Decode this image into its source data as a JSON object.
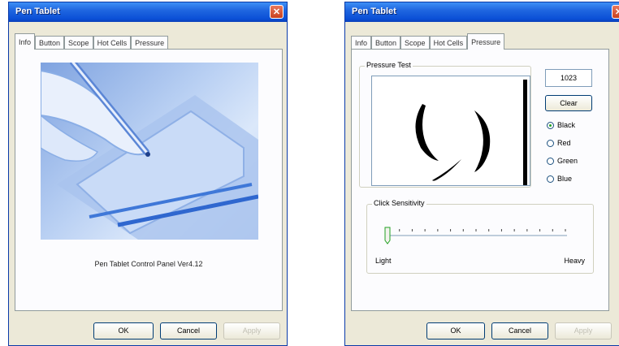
{
  "window_left": {
    "title": "Pen Tablet",
    "tabs": [
      "Info",
      "Button",
      "Scope",
      "Hot Cells",
      "Pressure"
    ],
    "active_tab": "Info",
    "caption": "Pen Tablet Control Panel Ver4.12",
    "buttons": {
      "ok": "OK",
      "cancel": "Cancel",
      "apply": "Apply"
    }
  },
  "window_right": {
    "title": "Pen Tablet",
    "tabs": [
      "Info",
      "Button",
      "Scope",
      "Hot Cells",
      "Pressure"
    ],
    "active_tab": "Pressure",
    "pressure_group_label": "Pressure Test",
    "pressure_value": "1023",
    "clear_label": "Clear",
    "colors": [
      {
        "label": "Black",
        "checked": true
      },
      {
        "label": "Red",
        "checked": false
      },
      {
        "label": "Green",
        "checked": false
      },
      {
        "label": "Blue",
        "checked": false
      }
    ],
    "click_group_label": "Click Sensitivity",
    "slider_left_label": "Light",
    "slider_right_label": "Heavy",
    "slider_ticks": 15,
    "slider_value": 0,
    "buttons": {
      "ok": "OK",
      "cancel": "Cancel",
      "apply": "Apply"
    }
  },
  "icons": {
    "close": "close-icon",
    "pen": "pen-icon"
  }
}
